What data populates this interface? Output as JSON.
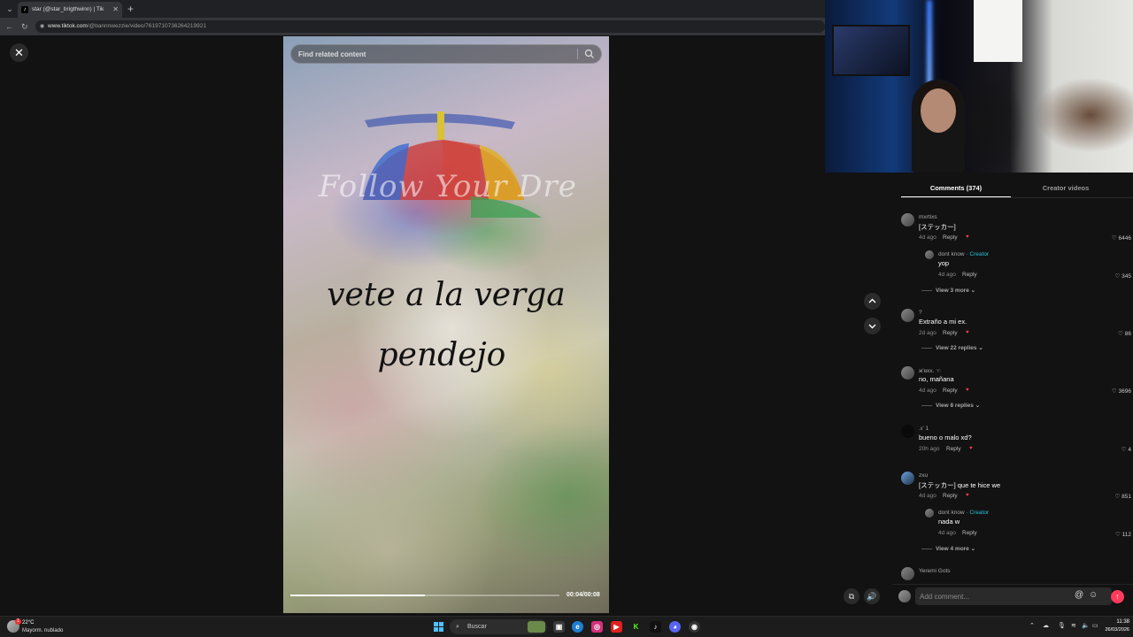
{
  "browser": {
    "tab_title": "star (@star_brigthwinn) | Tik",
    "tab_favicon": "tiktok-icon",
    "url_domain": "www.tiktok.com",
    "url_path": "/@bannnwezzie/video/7619710736264219921"
  },
  "video": {
    "search_placeholder": "Find related content",
    "watermark_text": "Follow Your Dre",
    "overlay_line1": "vete a la verga",
    "overlay_line2": "pendejo",
    "time": "00:04/00:08",
    "progress": 0.5
  },
  "tabs": {
    "comments_label": "Comments (374)",
    "creator_label": "Creator videos"
  },
  "comments": [
    {
      "user": "mxrtixs",
      "text": "[ステッカー]",
      "time": "4d ago",
      "reply": "Reply",
      "likes": "6446",
      "sub_reply": {
        "user": "dont know",
        "creator": "· Creator",
        "text": "yop",
        "time": "4d ago",
        "reply": "Reply",
        "likes": "345"
      },
      "view_more": "View 3 more"
    },
    {
      "user": "?",
      "text": "Extraño a mi ex.",
      "time": "2d ago",
      "reply": "Reply",
      "likes": "86",
      "view_more": "View 22 replies"
    },
    {
      "user": "ж'ехх. ☜",
      "text": "no, mañana",
      "time": "4d ago",
      "reply": "Reply",
      "likes": "3696",
      "view_more": "View 8 replies"
    },
    {
      "user": ".𝔵' 1",
      "text": "bueno o malo xd?",
      "time": "20h ago",
      "reply": "Reply",
      "likes": "4"
    },
    {
      "user": "zxu",
      "text": "[ステッカー] que te hice we",
      "time": "4d ago",
      "reply": "Reply",
      "likes": "851",
      "sub_reply": {
        "user": "dont know",
        "creator": "· Creator",
        "text": "nada w",
        "time": "4d ago",
        "reply": "Reply",
        "likes": "112"
      },
      "view_more": "View 4 more"
    },
    {
      "user": "Yeremi Gots"
    }
  ],
  "comment_input": {
    "placeholder": "Add comment...",
    "at": "@",
    "emoji": "☺",
    "send": "↑"
  },
  "taskbar": {
    "temp": "22°C",
    "weather": "Mayorm. nublado",
    "weather_badge": "1",
    "search_label": "Buscar",
    "time": "11:38",
    "date": "26/03/2026"
  },
  "colors": {
    "accent": "#ff3b5c",
    "creator": "#25c2d7",
    "background": "#121212"
  }
}
